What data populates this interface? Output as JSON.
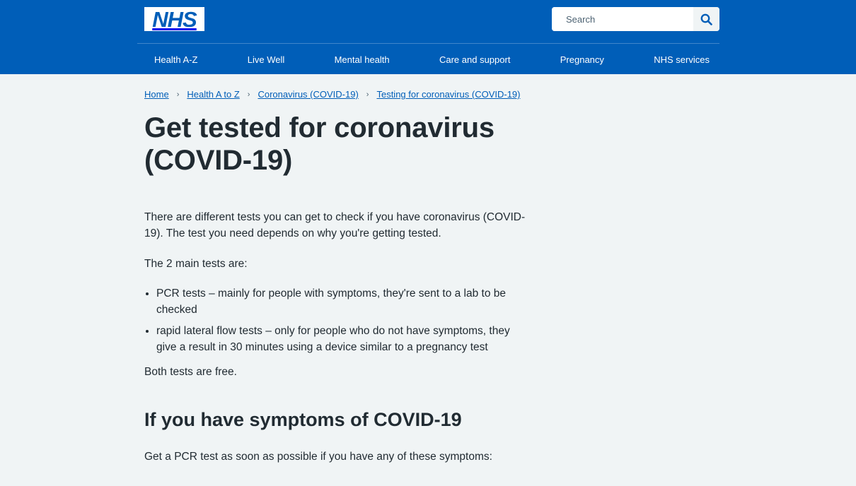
{
  "header": {
    "logo_text": "NHS",
    "search": {
      "placeholder": "Search",
      "icon": "search-icon"
    },
    "nav": [
      "Health A-Z",
      "Live Well",
      "Mental health",
      "Care and support",
      "Pregnancy",
      "NHS services"
    ]
  },
  "breadcrumb": [
    "Home",
    "Health A to Z",
    "Coronavirus (COVID-19)",
    "Testing for coronavirus (COVID-19)"
  ],
  "page": {
    "title": "Get tested for coronavirus (COVID-19)",
    "intro": "There are different tests you can get to check if you have coronavirus (COVID-19). The test you need depends on why you're getting tested.",
    "lead": "The 2 main tests are:",
    "tests": [
      "PCR tests – mainly for people with symptoms, they're sent to a lab to be checked",
      "rapid lateral flow tests – only for people who do not have symptoms, they give a result in 30 minutes using a device similar to a pregnancy test"
    ],
    "both_free": "Both tests are free.",
    "section_heading": "If you have symptoms of COVID-19",
    "section_text": "Get a PCR test as soon as possible if you have any of these symptoms:"
  },
  "colors": {
    "brand": "#005eb8",
    "background": "#f0f4f5",
    "text": "#212b32"
  }
}
